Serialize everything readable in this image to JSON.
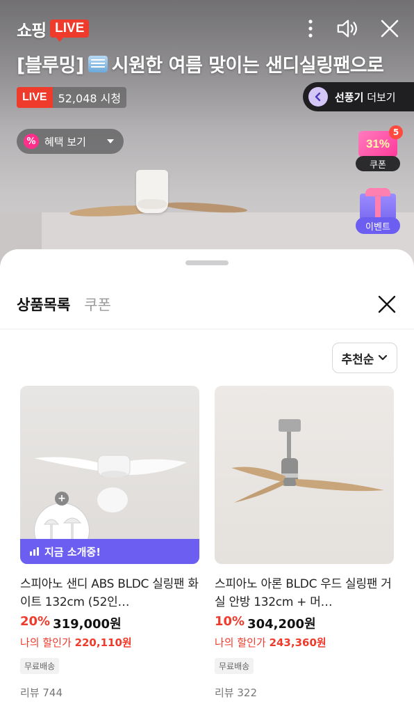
{
  "live": {
    "logo_text": "쇼핑",
    "logo_badge": "LIVE",
    "title_prefix": "[블루밍]",
    "title_main": "시원한 여름 맞이는 샌디실링팬으로",
    "live_badge": "LIVE",
    "viewer_count": "52,048 시청",
    "more_keyword": "선풍기",
    "more_label": "더보기",
    "benefit_icon": "%",
    "benefit_label": "혜택 보기",
    "coupon_pct": "31%",
    "coupon_count": "5",
    "coupon_label": "쿠폰",
    "event_label": "이벤트"
  },
  "sheet": {
    "tabs": [
      {
        "label": "상품목록",
        "active": true
      },
      {
        "label": "쿠폰",
        "active": false
      }
    ],
    "sort_label": "추천순",
    "products": [
      {
        "name": "스피아노 샌디 ABS BLDC 실링팬 화이트 132cm (52인…",
        "discount": "20%",
        "price": "319,000원",
        "my_price_label": "나의 할인가",
        "my_price": "220,110원",
        "shipping": "무료배송",
        "review": "리뷰 744",
        "now_label": "지금 소개중!"
      },
      {
        "name": "스피아노 아론 BLDC 우드 실링팬 거실 안방 132cm + 머…",
        "discount": "10%",
        "price": "304,200원",
        "my_price_label": "나의 할인가",
        "my_price": "243,360원",
        "shipping": "무료배송",
        "review": "리뷰 322"
      }
    ]
  },
  "colors": {
    "live_red": "#ef3b2c",
    "accent_purple": "#6b5ef0",
    "discount_red": "#ef3b2c"
  },
  "icons": [
    "more-vertical-icon",
    "speaker-icon",
    "close-icon",
    "chevron-left-icon",
    "chevron-down-icon",
    "percent-icon",
    "gift-icon",
    "signal-bars-icon",
    "plus-icon"
  ]
}
